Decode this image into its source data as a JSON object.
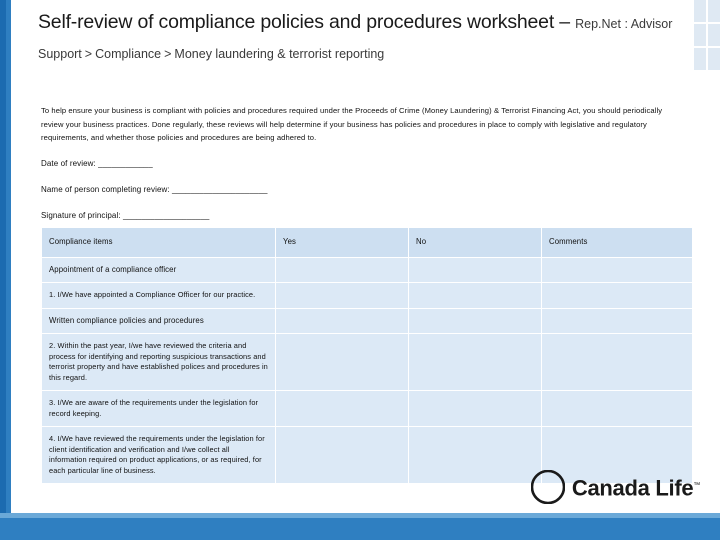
{
  "slide": {
    "title_main": "Self-review of compliance policies and procedures worksheet – ",
    "breadcrumb": [
      "Rep.Net : Advisor Support",
      "Compliance",
      "Money laundering & terrorist reporting"
    ],
    "breadcrumb_separator": ">",
    "body_paragraph": "To help ensure your business is compliant with policies and procedures required under the Proceeds of Crime (Money Laundering) & Terrorist Financing Act, you should periodically review your business practices. Done regularly, these reviews will help determine if your business has policies and procedures in place to comply with legislative and regulatory requirements, and whether those policies and procedures are being adhered to.",
    "fields": [
      "Date of review: ____________",
      "Name of person completing review: _____________________",
      "Signature of principal: ___________________"
    ],
    "table": {
      "headers": [
        "Compliance items",
        "Yes",
        "No",
        "Comments"
      ],
      "rows": [
        {
          "type": "section",
          "label": "Appointment of a compliance officer"
        },
        {
          "type": "item",
          "label": "1. I/We have appointed a Compliance Officer for our practice."
        },
        {
          "type": "section",
          "label": "Written compliance policies and procedures"
        },
        {
          "type": "item",
          "label": "2. Within the past year, I/we have reviewed the criteria and process for identifying and reporting suspicious transactions and terrorist property and have established polices and procedures in this regard."
        },
        {
          "type": "item",
          "label": "3. I/We are aware of the requirements under the legislation for record keeping."
        },
        {
          "type": "item",
          "label": "4. I/We have reviewed the requirements under the legislation for client identification and verification and I/we collect all information required on product applications, or as required, for each particular line of business."
        }
      ]
    },
    "logo": {
      "name": "Canada Life",
      "trademark": "™"
    },
    "colors": {
      "accent_blue": "#2f7fc1",
      "table_fill": "#dce9f6",
      "table_header_fill": "#cddff1"
    }
  }
}
